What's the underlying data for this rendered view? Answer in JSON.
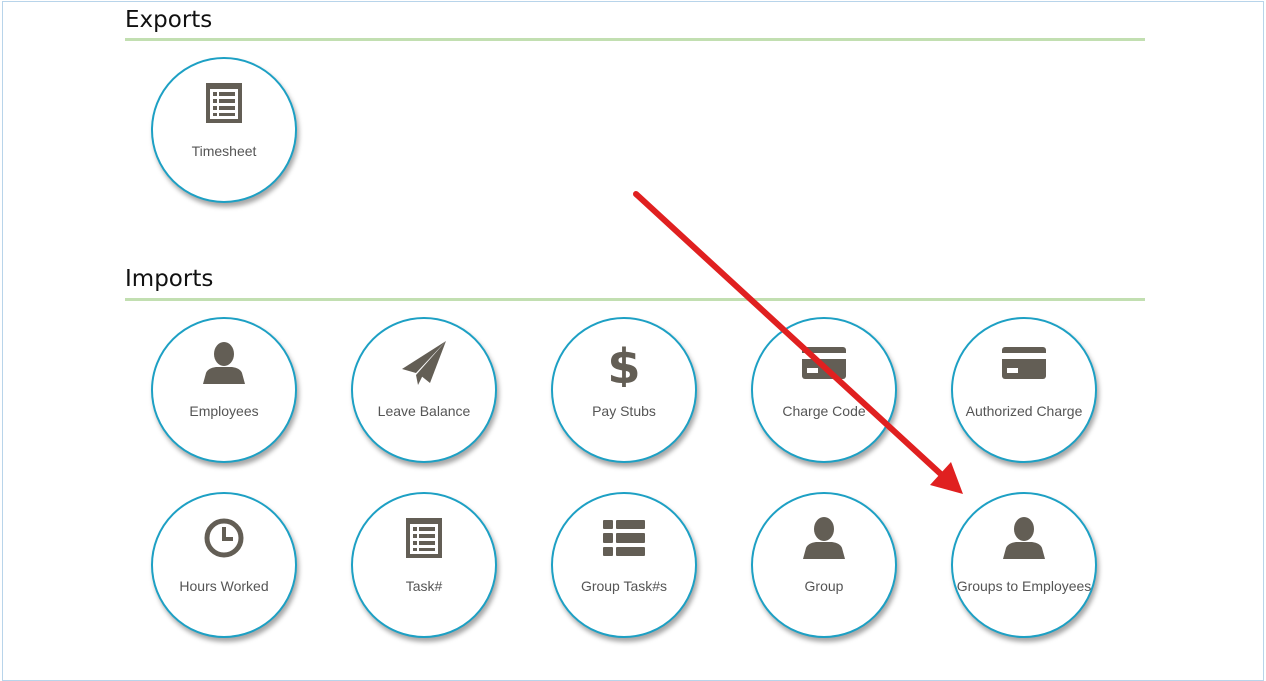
{
  "exports": {
    "title": "Exports",
    "tiles": [
      {
        "label": "Timesheet",
        "icon": "list-document-icon"
      }
    ]
  },
  "imports": {
    "title": "Imports",
    "tiles": [
      {
        "label": "Employees",
        "icon": "user-icon"
      },
      {
        "label": "Leave Balance",
        "icon": "paper-plane-icon"
      },
      {
        "label": "Pay Stubs",
        "icon": "dollar-icon"
      },
      {
        "label": "Charge Code",
        "icon": "credit-card-icon"
      },
      {
        "label": "Authorized Charge",
        "icon": "credit-card-icon"
      },
      {
        "label": "Hours Worked",
        "icon": "clock-icon"
      },
      {
        "label": "Task#",
        "icon": "list-document-icon"
      },
      {
        "label": "Group Task#s",
        "icon": "list-icon"
      },
      {
        "label": "Group",
        "icon": "user-icon"
      },
      {
        "label": "Groups to Employees",
        "icon": "user-icon"
      }
    ]
  },
  "colors": {
    "tile_border": "#1da0c4",
    "divider": "#c2dfb1",
    "icon": "#635e55",
    "annotation_arrow": "#e02020"
  }
}
